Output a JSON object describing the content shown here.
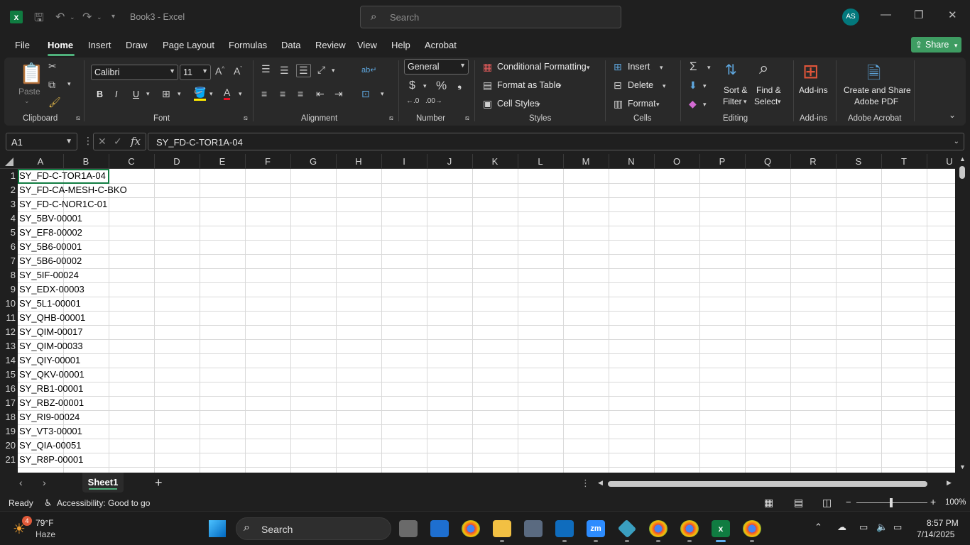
{
  "titlebar": {
    "app_icon": "excel-icon",
    "doc_title": "Book3  -  Excel",
    "search_placeholder": "Search",
    "avatar_initials": "AS"
  },
  "menu": {
    "tabs": [
      "File",
      "Home",
      "Insert",
      "Draw",
      "Page Layout",
      "Formulas",
      "Data",
      "Review",
      "View",
      "Help",
      "Acrobat"
    ],
    "active_tab": "Home",
    "share_label": "Share"
  },
  "ribbon": {
    "clipboard": {
      "paste": "Paste",
      "label": "Clipboard"
    },
    "font": {
      "name": "Calibri",
      "size": "11",
      "bold": "B",
      "italic": "I",
      "underline": "U",
      "label": "Font"
    },
    "alignment": {
      "label": "Alignment"
    },
    "number": {
      "format": "General",
      "label": "Number"
    },
    "styles": {
      "conditional": "Conditional Formatting",
      "table": "Format as Table",
      "cell_styles": "Cell Styles",
      "label": "Styles"
    },
    "cells": {
      "insert": "Insert",
      "delete": "Delete",
      "format": "Format",
      "label": "Cells"
    },
    "editing": {
      "sort1": "Sort &",
      "sort2": "Filter",
      "find1": "Find &",
      "find2": "Select",
      "label": "Editing"
    },
    "addins": {
      "btn": "Add-ins",
      "label": "Add-ins"
    },
    "acrobat": {
      "line1": "Create and Share",
      "line2": "Adobe PDF",
      "label": "Adobe Acrobat"
    }
  },
  "formula_bar": {
    "name_box": "A1",
    "formula": "SY_FD-C-TOR1A-04"
  },
  "grid": {
    "columns": [
      "A",
      "B",
      "C",
      "D",
      "E",
      "F",
      "G",
      "H",
      "I",
      "J",
      "K",
      "L",
      "M",
      "N",
      "O",
      "P",
      "Q",
      "R",
      "S",
      "T",
      "U"
    ],
    "rows": [
      "1",
      "2",
      "3",
      "4",
      "5",
      "6",
      "7",
      "8",
      "9",
      "10",
      "11",
      "12",
      "13",
      "14",
      "15",
      "16",
      "17",
      "18",
      "19",
      "20",
      "21"
    ],
    "column_a": [
      "SY_FD-C-TOR1A-04",
      "SY_FD-CA-MESH-C-BKO",
      "SY_FD-C-NOR1C-01",
      "SY_5BV-00001",
      "SY_EF8-00002",
      "SY_5B6-00001",
      "SY_5B6-00002",
      "SY_5IF-00024",
      "SY_EDX-00003",
      "SY_5L1-00001",
      "SY_QHB-00001",
      "SY_QIM-00017",
      "SY_QIM-00033",
      "SY_QIY-00001",
      "SY_QKV-00001",
      "SY_RB1-00001",
      "SY_RBZ-00001",
      "SY_RI9-00024",
      "SY_VT3-00001",
      "SY_QIA-00051",
      "SY_R8P-00001"
    ]
  },
  "sheets": {
    "active": "Sheet1"
  },
  "status": {
    "ready": "Ready",
    "accessibility": "Accessibility: Good to go",
    "zoom": "100%"
  },
  "taskbar": {
    "weather_temp": "79°F",
    "weather_desc": "Haze",
    "weather_badge": "4",
    "search": "Search",
    "time": "8:57 PM",
    "date": "7/14/2025"
  }
}
